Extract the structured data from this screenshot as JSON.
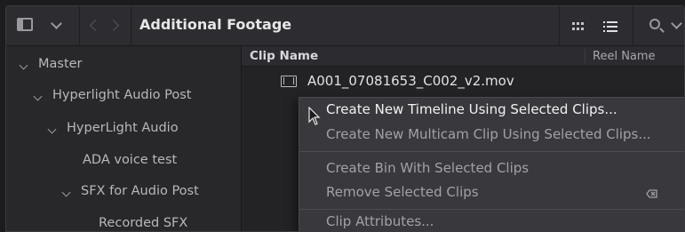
{
  "toolbar": {
    "title": "Additional Footage",
    "icons": [
      "panel-toggle-icon",
      "chevron-down-icon",
      "back-arrow-icon",
      "forward-arrow-icon",
      "thumbnail-view-icon",
      "list-view-icon",
      "search-icon",
      "chevron-down-icon"
    ]
  },
  "sidebar": {
    "items": [
      {
        "label": "Master",
        "expanded": true
      },
      {
        "label": "Hyperlight Audio Post",
        "expanded": true
      },
      {
        "label": "HyperLight Audio",
        "expanded": true
      },
      {
        "label": "ADA voice test"
      },
      {
        "label": "SFX for Audio Post",
        "expanded": true
      },
      {
        "label": "Recorded SFX"
      }
    ]
  },
  "clip_list": {
    "columns": [
      "Clip Name",
      "Reel Name"
    ],
    "rows": [
      {
        "name": "A001_07081653_C002_v2.mov"
      }
    ]
  },
  "context_menu": {
    "items": [
      "Create New Timeline Using Selected Clips...",
      "Create New Multicam Clip Using Selected Clips...",
      "Create Bin With Selected Clips",
      "Remove Selected Clips",
      "Clip Attributes..."
    ]
  },
  "colors": {
    "background": "#26262a",
    "menu_background": "#39393d",
    "text_primary": "#e2e2e4",
    "text_dim": "#a2a2a6"
  }
}
